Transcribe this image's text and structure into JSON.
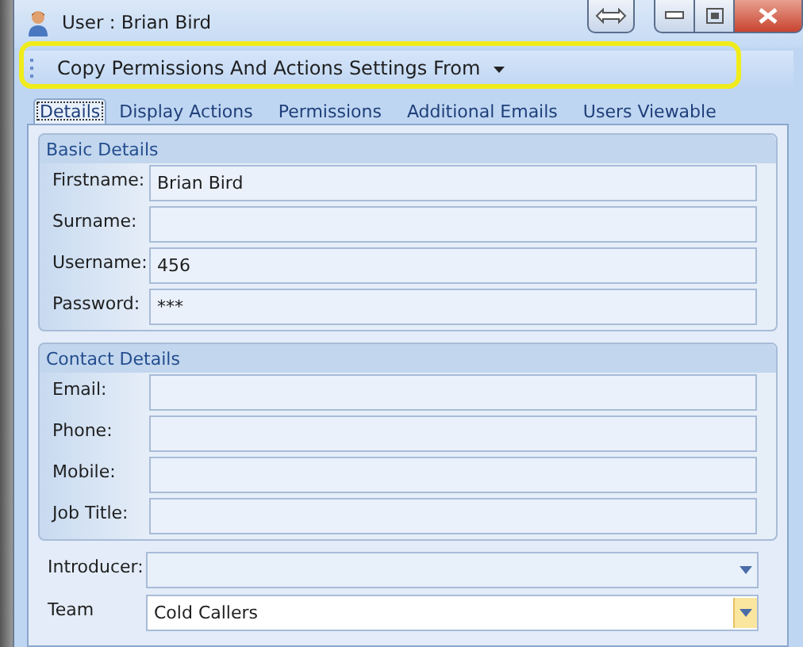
{
  "window": {
    "title": "User : Brian Bird"
  },
  "toolbar": {
    "menu": "Copy Permissions And Actions Settings From"
  },
  "tabs": [
    {
      "label": "Details",
      "selected": true
    },
    {
      "label": "Display Actions",
      "selected": false
    },
    {
      "label": "Permissions",
      "selected": false
    },
    {
      "label": "Additional Emails",
      "selected": false
    },
    {
      "label": "Users Viewable",
      "selected": false
    }
  ],
  "groups": [
    {
      "title": "Basic Details",
      "fields": [
        {
          "label": "Firstname:",
          "value": "Brian Bird"
        },
        {
          "label": "Surname:"
        },
        {
          "label": "Username:",
          "value": "456"
        },
        {
          "label": "Password:",
          "value": "***"
        }
      ]
    },
    {
      "title": "Contact Details",
      "fields": [
        {
          "label": "Email:"
        },
        {
          "label": "Phone:"
        },
        {
          "label": "Mobile:"
        },
        {
          "label": "Job Title:"
        }
      ]
    }
  ],
  "combos": [
    {
      "label": "Introducer:",
      "focused": false
    },
    {
      "label": "Team",
      "value": "Cold Callers",
      "focused": true
    }
  ]
}
